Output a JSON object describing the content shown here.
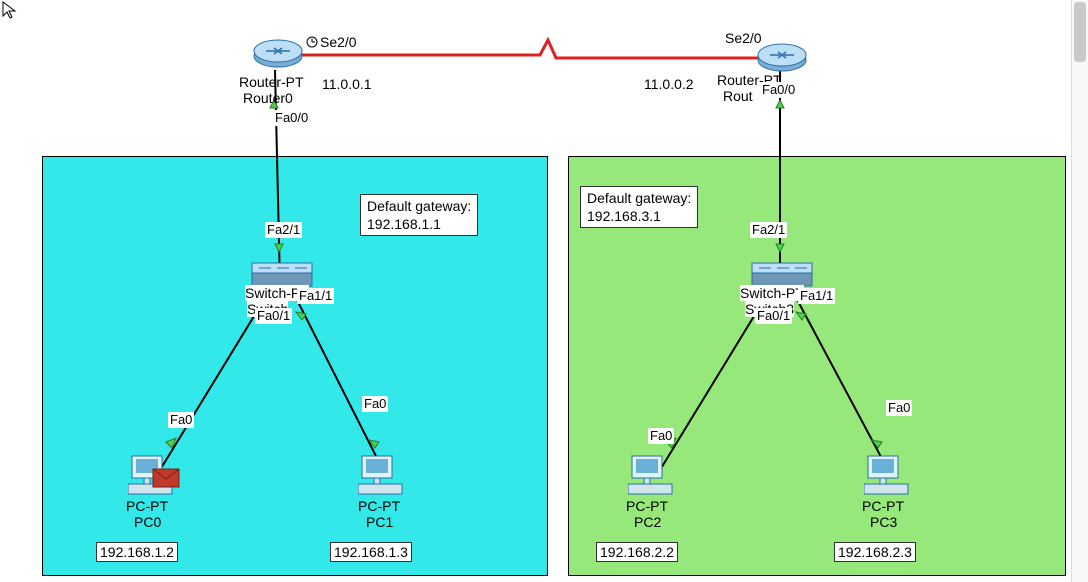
{
  "cursor": "default-cursor",
  "zones": {
    "left": {
      "color": "#33e8e8"
    },
    "right": {
      "color": "#97e87a"
    }
  },
  "serial_link_color": "#e02020",
  "routers": {
    "r0": {
      "type": "Router-PT",
      "name": "Router0",
      "serial_port": "Se2/0",
      "serial_ip": "11.0.0.1",
      "lan_port": "Fa0/0"
    },
    "r1": {
      "type": "Router-PT",
      "name": "Router1",
      "name_shown": "Rout",
      "serial_port": "Se2/0",
      "serial_ip": "11.0.0.2",
      "lan_port": "Fa0/0"
    }
  },
  "switches": {
    "s0": {
      "type": "Switch-PT",
      "name": "Switch0",
      "name_shown": "Switch",
      "uplink_port": "Fa2/1",
      "port_a": "Fa0/1",
      "port_b": "Fa1/1"
    },
    "s1": {
      "type": "Switch-PT",
      "name": "Switch3",
      "uplink_port": "Fa2/1",
      "port_a": "Fa0/1",
      "port_b": "Fa1/1"
    }
  },
  "pcs": {
    "pc0": {
      "type": "PC-PT",
      "name": "PC0",
      "port": "Fa0",
      "ip": "192.168.1.2"
    },
    "pc1": {
      "type": "PC-PT",
      "name": "PC1",
      "port": "Fa0",
      "ip": "192.168.1.3"
    },
    "pc2": {
      "type": "PC-PT",
      "name": "PC2",
      "port": "Fa0",
      "ip": "192.168.2.2"
    },
    "pc3": {
      "type": "PC-PT",
      "name": "PC3",
      "port": "Fa0",
      "ip": "192.168.2.3"
    }
  },
  "gateways": {
    "left": {
      "line1": "Default gateway:",
      "line2": "192.168.1.1"
    },
    "right": {
      "line1": "Default gateway:",
      "line2": "192.168.3.1"
    }
  },
  "pdu": {
    "at": "PC0",
    "icon": "envelope"
  }
}
